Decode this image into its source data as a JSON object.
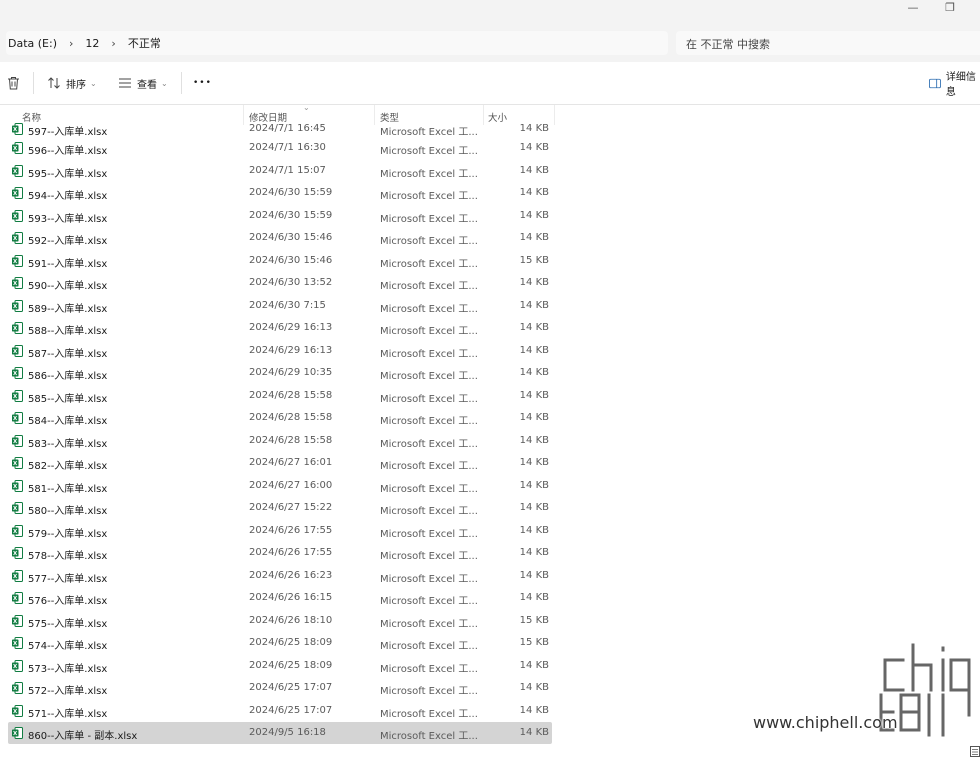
{
  "window": {
    "minimize": "—",
    "restore": "❐"
  },
  "address": {
    "crumbs": [
      "Data (E:)",
      "12",
      "不正常"
    ],
    "search_placeholder": "在 不正常 中搜索"
  },
  "toolbar": {
    "sort_label": "排序",
    "view_label": "查看",
    "more_label": "•••",
    "details_label": "详细信息"
  },
  "columns": {
    "name": "名称",
    "date": "修改日期",
    "type": "类型",
    "size": "大小"
  },
  "partial_row": {
    "name": "597--入库单.xlsx",
    "date": "2024/7/1 16:45",
    "type": "Microsoft Excel 工...",
    "size": "14 KB"
  },
  "files": [
    {
      "name": "596--入库单.xlsx",
      "date": "2024/7/1 16:30",
      "type": "Microsoft Excel 工...",
      "size": "14 KB"
    },
    {
      "name": "595--入库单.xlsx",
      "date": "2024/7/1 15:07",
      "type": "Microsoft Excel 工...",
      "size": "14 KB"
    },
    {
      "name": "594--入库单.xlsx",
      "date": "2024/6/30 15:59",
      "type": "Microsoft Excel 工...",
      "size": "14 KB"
    },
    {
      "name": "593--入库单.xlsx",
      "date": "2024/6/30 15:59",
      "type": "Microsoft Excel 工...",
      "size": "14 KB"
    },
    {
      "name": "592--入库单.xlsx",
      "date": "2024/6/30 15:46",
      "type": "Microsoft Excel 工...",
      "size": "14 KB"
    },
    {
      "name": "591--入库单.xlsx",
      "date": "2024/6/30 15:46",
      "type": "Microsoft Excel 工...",
      "size": "15 KB"
    },
    {
      "name": "590--入库单.xlsx",
      "date": "2024/6/30 13:52",
      "type": "Microsoft Excel 工...",
      "size": "14 KB"
    },
    {
      "name": "589--入库单.xlsx",
      "date": "2024/6/30 7:15",
      "type": "Microsoft Excel 工...",
      "size": "14 KB"
    },
    {
      "name": "588--入库单.xlsx",
      "date": "2024/6/29 16:13",
      "type": "Microsoft Excel 工...",
      "size": "14 KB"
    },
    {
      "name": "587--入库单.xlsx",
      "date": "2024/6/29 16:13",
      "type": "Microsoft Excel 工...",
      "size": "14 KB"
    },
    {
      "name": "586--入库单.xlsx",
      "date": "2024/6/29 10:35",
      "type": "Microsoft Excel 工...",
      "size": "14 KB"
    },
    {
      "name": "585--入库单.xlsx",
      "date": "2024/6/28 15:58",
      "type": "Microsoft Excel 工...",
      "size": "14 KB"
    },
    {
      "name": "584--入库单.xlsx",
      "date": "2024/6/28 15:58",
      "type": "Microsoft Excel 工...",
      "size": "14 KB"
    },
    {
      "name": "583--入库单.xlsx",
      "date": "2024/6/28 15:58",
      "type": "Microsoft Excel 工...",
      "size": "14 KB"
    },
    {
      "name": "582--入库单.xlsx",
      "date": "2024/6/27 16:01",
      "type": "Microsoft Excel 工...",
      "size": "14 KB"
    },
    {
      "name": "581--入库单.xlsx",
      "date": "2024/6/27 16:00",
      "type": "Microsoft Excel 工...",
      "size": "14 KB"
    },
    {
      "name": "580--入库单.xlsx",
      "date": "2024/6/27 15:22",
      "type": "Microsoft Excel 工...",
      "size": "14 KB"
    },
    {
      "name": "579--入库单.xlsx",
      "date": "2024/6/26 17:55",
      "type": "Microsoft Excel 工...",
      "size": "14 KB"
    },
    {
      "name": "578--入库单.xlsx",
      "date": "2024/6/26 17:55",
      "type": "Microsoft Excel 工...",
      "size": "14 KB"
    },
    {
      "name": "577--入库单.xlsx",
      "date": "2024/6/26 16:23",
      "type": "Microsoft Excel 工...",
      "size": "14 KB"
    },
    {
      "name": "576--入库单.xlsx",
      "date": "2024/6/26 16:15",
      "type": "Microsoft Excel 工...",
      "size": "14 KB"
    },
    {
      "name": "575--入库单.xlsx",
      "date": "2024/6/26 18:10",
      "type": "Microsoft Excel 工...",
      "size": "15 KB"
    },
    {
      "name": "574--入库单.xlsx",
      "date": "2024/6/25 18:09",
      "type": "Microsoft Excel 工...",
      "size": "15 KB"
    },
    {
      "name": "573--入库单.xlsx",
      "date": "2024/6/25 18:09",
      "type": "Microsoft Excel 工...",
      "size": "14 KB"
    },
    {
      "name": "572--入库单.xlsx",
      "date": "2024/6/25 17:07",
      "type": "Microsoft Excel 工...",
      "size": "14 KB"
    },
    {
      "name": "571--入库单.xlsx",
      "date": "2024/6/25 17:07",
      "type": "Microsoft Excel 工...",
      "size": "14 KB"
    },
    {
      "name": "860--入库单 - 副本.xlsx",
      "date": "2024/9/5 16:18",
      "type": "Microsoft Excel 工...",
      "size": "14 KB",
      "selected": true
    }
  ],
  "watermark": {
    "logo_text": "chip hell",
    "url": "www.chiphell.com"
  },
  "colors": {
    "excel_green": "#107c41",
    "selected_row": "#d4d4d4",
    "chrome_bg": "#f3f3f3"
  }
}
